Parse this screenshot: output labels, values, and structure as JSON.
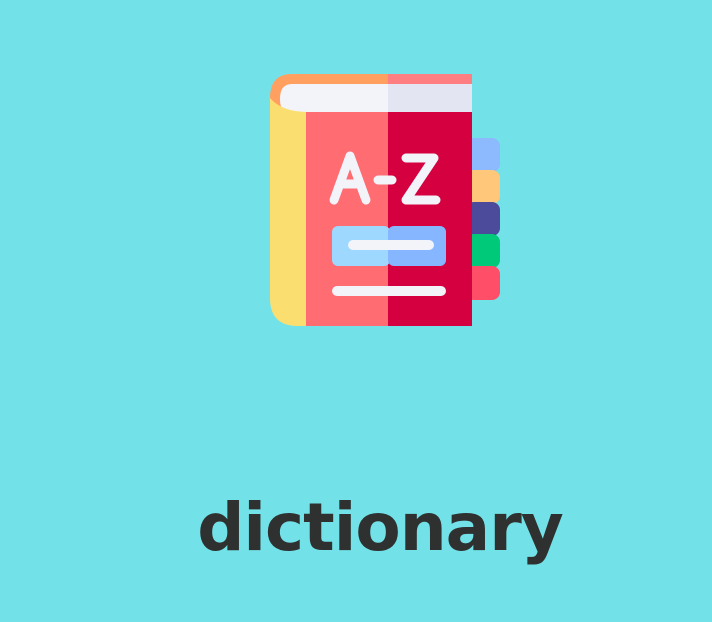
{
  "word": {
    "text": "dictionary"
  },
  "icon": {
    "name": "dictionary-book-icon",
    "label": "A-Z"
  },
  "colors": {
    "background": "#72E2E8",
    "text": "#2F3131",
    "cover_left": "#FF6C72",
    "cover_right": "#D5003F",
    "spine": "#FBDE70",
    "pages_top": "#F2F4FA",
    "pages_accent": "#FFA060",
    "tab_blue": "#8DB9FF",
    "tab_yellow": "#FFC779",
    "tab_purple": "#4C4A9A",
    "tab_green": "#00C97A",
    "tab_red": "#FF4F68",
    "label_box": "#9FD8FF"
  }
}
